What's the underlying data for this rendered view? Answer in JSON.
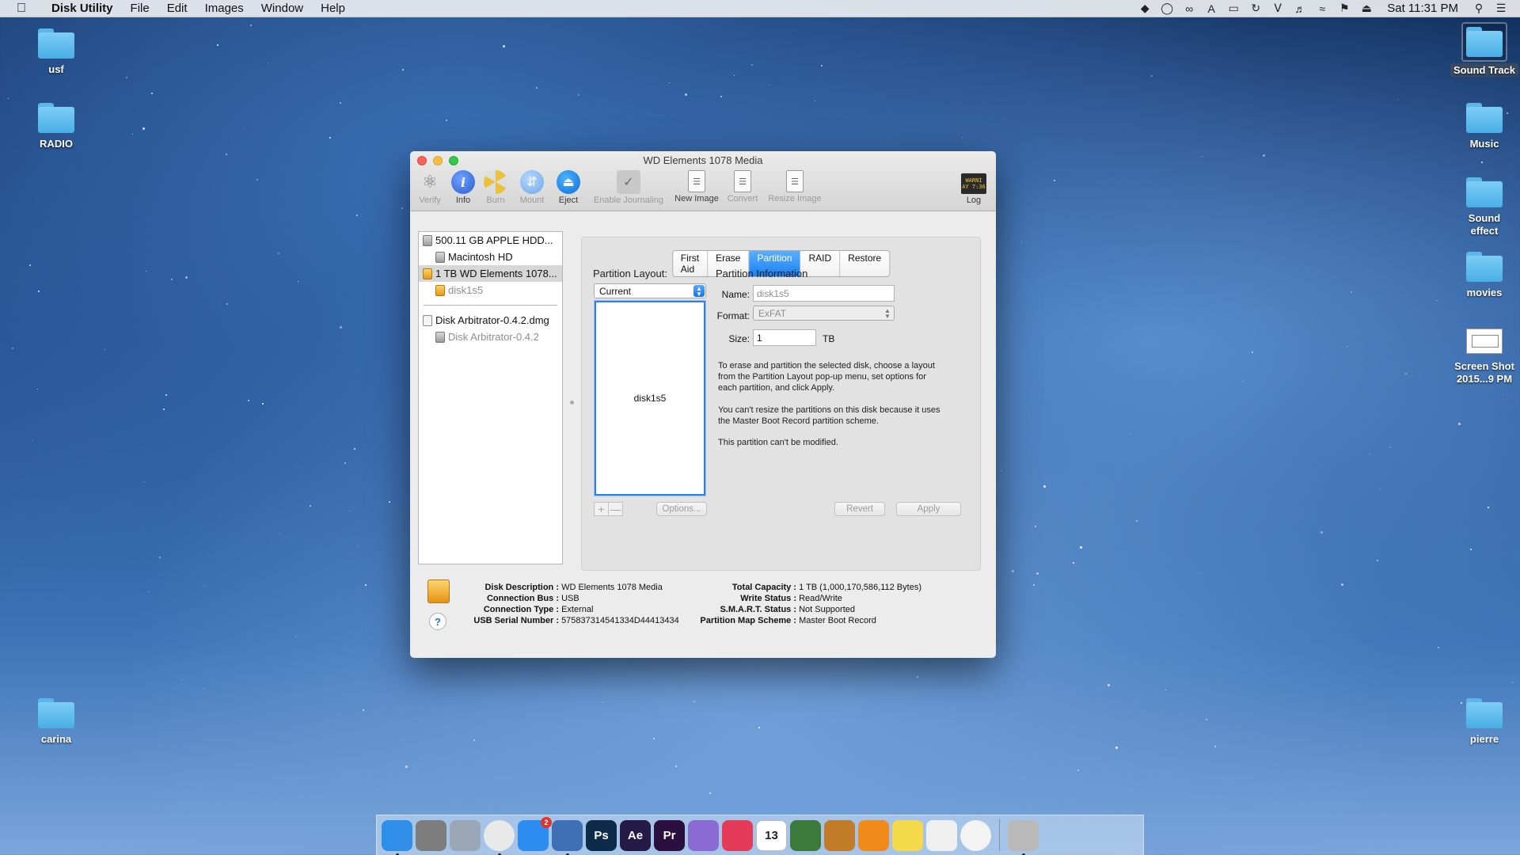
{
  "menubar": {
    "app_name": "Disk Utility",
    "items": [
      "File",
      "Edit",
      "Images",
      "Window",
      "Help"
    ],
    "clock": "Sat 11:31 PM"
  },
  "desktop_icons": {
    "left": [
      "usf",
      "RADIO",
      "carina"
    ],
    "right": [
      "Sound Track",
      "Music",
      "Sound effect",
      "movies",
      "Screen Shot 2015...9 PM",
      "pierre"
    ]
  },
  "window": {
    "title": "WD Elements 1078 Media",
    "toolbar": {
      "verify": "Verify",
      "info": "Info",
      "burn": "Burn",
      "mount": "Mount",
      "eject": "Eject",
      "enable_journaling": "Enable Journaling",
      "new_image": "New Image",
      "convert": "Convert",
      "resize_image": "Resize Image",
      "log": "Log",
      "log_icon_text": "WARNI\nAY 7:36"
    },
    "sidebar": {
      "items": [
        {
          "label": "500.11 GB APPLE HDD...",
          "indent": false,
          "icon": "hdd-icon"
        },
        {
          "label": "Macintosh HD",
          "indent": true,
          "icon": "hdd-icon"
        },
        {
          "label": "1 TB WD Elements 1078...",
          "indent": false,
          "icon": "external-drive-icon",
          "selected": true
        },
        {
          "label": "disk1s5",
          "indent": true,
          "icon": "external-drive-icon",
          "dim": true
        },
        {
          "label": "Disk Arbitrator-0.4.2.dmg",
          "indent": false,
          "icon": "disk-image-icon"
        },
        {
          "label": "Disk Arbitrator-0.4.2",
          "indent": true,
          "icon": "volume-icon",
          "dim": true
        }
      ]
    },
    "tabs": [
      "First Aid",
      "Erase",
      "Partition",
      "RAID",
      "Restore"
    ],
    "active_tab": "Partition",
    "partition": {
      "layout_label": "Partition Layout:",
      "layout_value": "Current",
      "map_label": "disk1s5",
      "info_title": "Partition Information",
      "name_label": "Name:",
      "name_value": "disk1s5",
      "format_label": "Format:",
      "format_value": "ExFAT",
      "size_label": "Size:",
      "size_value": "1",
      "size_unit": "TB",
      "help_1": "To erase and partition the selected disk, choose a layout from the Partition Layout pop-up menu, set options for each partition, and click Apply.",
      "help_2": "You can't resize the partitions on this disk because it uses the Master Boot Record partition scheme.",
      "help_3": "This partition can't be modified.",
      "add": "+",
      "remove": "—",
      "options": "Options...",
      "revert": "Revert",
      "apply": "Apply"
    },
    "info": {
      "disk_description_k": "Disk Description :",
      "disk_description_v": "WD Elements 1078 Media",
      "connection_bus_k": "Connection Bus :",
      "connection_bus_v": "USB",
      "connection_type_k": "Connection Type :",
      "connection_type_v": "External",
      "usb_serial_k": "USB Serial Number :",
      "usb_serial_v": "575837314541334D44413434",
      "total_capacity_k": "Total Capacity :",
      "total_capacity_v": "1 TB (1,000,170,586,112 Bytes)",
      "write_status_k": "Write Status :",
      "write_status_v": "Read/Write",
      "smart_k": "S.M.A.R.T. Status :",
      "smart_v": "Not Supported",
      "pms_k": "Partition Map Scheme :",
      "pms_v": "Master Boot Record",
      "help": "?"
    }
  },
  "dock": {
    "apps": [
      {
        "name": "finder-icon",
        "label": "",
        "color": "#2f8ee8"
      },
      {
        "name": "system-preferences-icon",
        "label": "",
        "color": "#7d7d7d"
      },
      {
        "name": "preview-icon",
        "label": "",
        "color": "#9aa7b6"
      },
      {
        "name": "chrome-icon",
        "label": "",
        "color": "#e9e9e9"
      },
      {
        "name": "app-store-icon",
        "label": "",
        "color": "#2b8df0",
        "badge": "2"
      },
      {
        "name": "disk-utility-icon",
        "label": "",
        "color": "#3f6fb5"
      },
      {
        "name": "photoshop-icon",
        "label": "Ps",
        "color": "#0d2a4a"
      },
      {
        "name": "after-effects-icon",
        "label": "Ae",
        "color": "#231a45"
      },
      {
        "name": "premiere-icon",
        "label": "Pr",
        "color": "#2a0f3f"
      },
      {
        "name": "imac-icon",
        "label": "",
        "color": "#8a6bd1"
      },
      {
        "name": "itunes-icon",
        "label": "",
        "color": "#e43b58"
      },
      {
        "name": "calendar-icon",
        "label": "13",
        "color": "#ffffff"
      },
      {
        "name": "photo-app-icon",
        "label": "",
        "color": "#3b7a3a"
      },
      {
        "name": "garageband-icon",
        "label": "",
        "color": "#c27b26"
      },
      {
        "name": "vlc-icon",
        "label": "",
        "color": "#f08a1a"
      },
      {
        "name": "stickies-icon",
        "label": "",
        "color": "#f4d94a"
      },
      {
        "name": "textedit-icon",
        "label": "",
        "color": "#efefef"
      },
      {
        "name": "photos-icon",
        "label": "",
        "color": "#f3f3f3"
      },
      {
        "name": "disk-utility-dock-icon",
        "label": "",
        "color": "#b9b9b9"
      }
    ]
  }
}
